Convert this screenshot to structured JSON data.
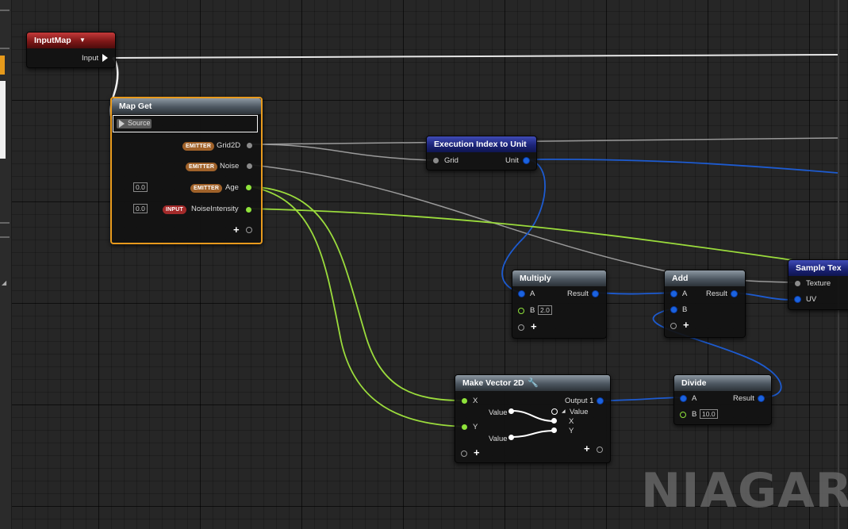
{
  "watermark": "NIAGARA",
  "nodes": {
    "inputmap": {
      "title": "InputMap",
      "pin": "Input"
    },
    "mapget": {
      "title": "Map Get",
      "source": "Source",
      "pins": [
        {
          "tag": "EMITTER",
          "name": "Grid2D"
        },
        {
          "tag": "EMITTER",
          "name": "Noise"
        },
        {
          "tag": "EMITTER",
          "name": "Age",
          "value": "0.0"
        },
        {
          "tag": "INPUT",
          "name": "NoiseIntensity",
          "value": "0.0"
        }
      ]
    },
    "execindex": {
      "title": "Execution Index to Unit",
      "in": "Grid",
      "out": "Unit"
    },
    "multiply": {
      "title": "Multiply",
      "a": "A",
      "b": "B",
      "b_value": "2.0",
      "result": "Result"
    },
    "add": {
      "title": "Add",
      "a": "A",
      "b": "B",
      "result": "Result"
    },
    "sampletex": {
      "title": "Sample Tex",
      "texture": "Texture",
      "uv": "UV"
    },
    "makevector": {
      "title": "Make Vector 2D",
      "x": "X",
      "y": "Y",
      "output": "Output 1",
      "value1": "Value",
      "value2": "Value",
      "out_value": "Value",
      "out_x": "X",
      "out_y": "Y"
    },
    "divide": {
      "title": "Divide",
      "a": "A",
      "b": "B",
      "b_value": "10.0",
      "result": "Result"
    }
  },
  "colors": {
    "float_pin": "#8fe33b",
    "vector_pin": "#1b63e0",
    "selection": "#e89a1d",
    "header_red": "#7e1717",
    "header_blue": "#1c2479",
    "header_gray": "#4c5660"
  },
  "icons": {
    "wrench": "wrench-icon",
    "dropdown": "chevron-down-icon"
  }
}
